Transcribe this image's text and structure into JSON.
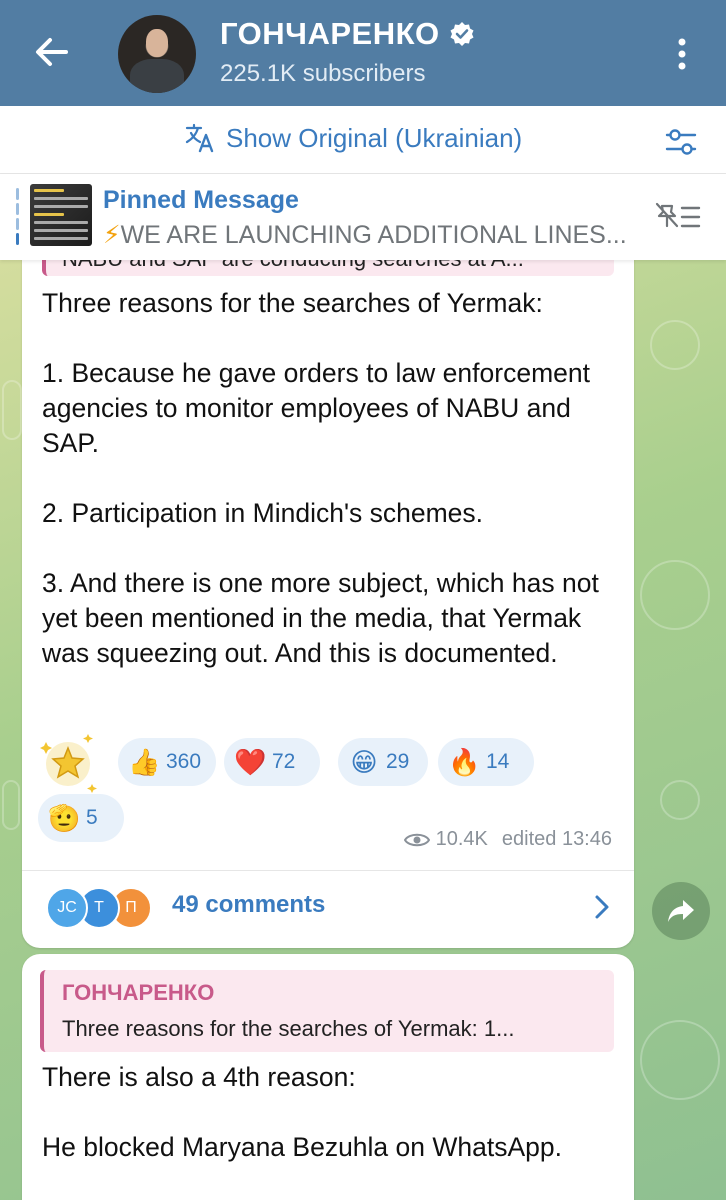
{
  "header": {
    "title": "ГОНЧАРЕНКО",
    "subtitle": "225.1K subscribers"
  },
  "translate_bar": {
    "label": "Show Original (Ukrainian)"
  },
  "pinned": {
    "title": "Pinned Message",
    "bolt": "⚡",
    "text": "WE ARE LAUNCHING ADDITIONAL LINES..."
  },
  "message1": {
    "quote_preview": "NABU and SAP are conducting searches at A...",
    "text": "Three reasons for the searches of Yermak:\n\n1. Because he gave orders to law enforcement agencies to monitor employees of NABU and SAP.\n\n2. Participation in Mindich's schemes.\n\n3. And there is one more subject, which has not yet been mentioned in the media, that Yermak was squeezing out. And this is documented.",
    "reactions": [
      {
        "emoji": "👍",
        "count": "360"
      },
      {
        "emoji": "❤️",
        "count": "72"
      },
      {
        "emoji": "😁",
        "count": "29"
      },
      {
        "emoji": "🔥",
        "count": "14"
      },
      {
        "emoji": "🫡",
        "count": "5"
      }
    ],
    "views": "10.4K",
    "edited": "edited 13:46",
    "comments": {
      "avatars": [
        "JC",
        "T",
        "П"
      ],
      "label": "49 comments"
    }
  },
  "message2": {
    "quote_author": "ГОНЧАРЕНКО",
    "quote_text": "Three reasons for the searches of Yermak:  1...",
    "text": "There is also a 4th reason:\n\nHe blocked Maryana Bezuhla on WhatsApp."
  },
  "colors": {
    "header_bg": "#527da3",
    "accent": "#3a7bbf",
    "quote_accent": "#c85a8a"
  }
}
